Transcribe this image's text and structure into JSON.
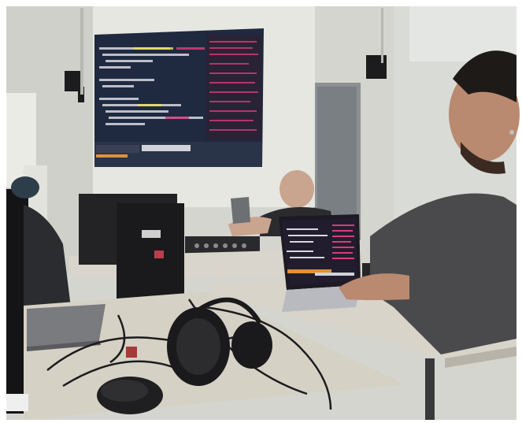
{
  "photo": {
    "colors": {
      "wall": "#d9dad4",
      "projection": "#e8e9e3",
      "editor_bg": "#1f2a40",
      "desk": "#d8d3c8",
      "shirt": "#4a4a4c",
      "laptop_screen": "#221d2e",
      "accent_orange": "#e0903a",
      "code_pink": "#d63c7a",
      "code_yellow": "#e8e24a"
    },
    "icons": [
      "speaker-icon",
      "headphones-icon",
      "mouse-icon",
      "laptop-icon",
      "mixer-icon"
    ]
  }
}
